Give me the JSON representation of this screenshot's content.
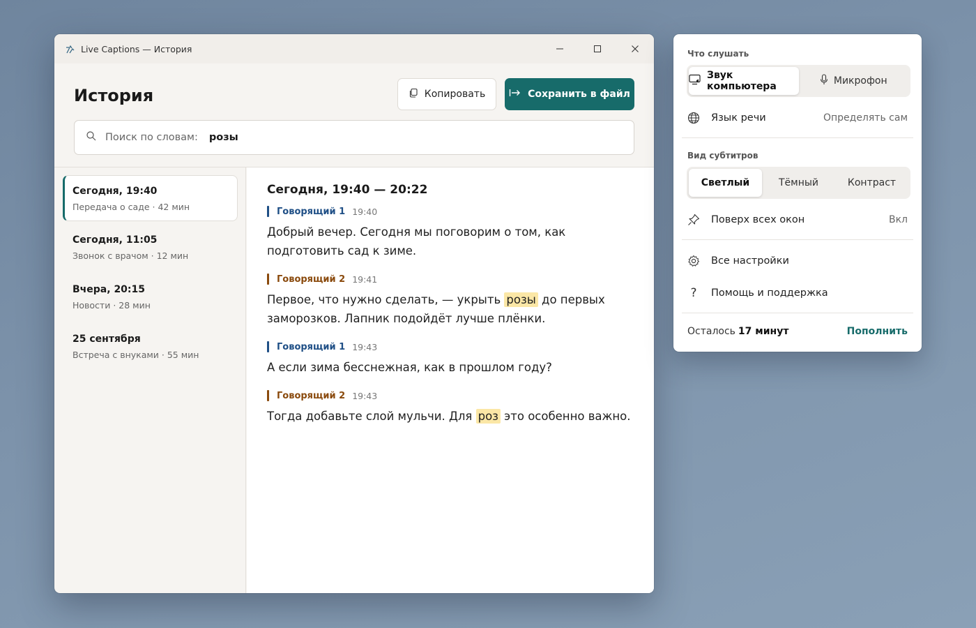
{
  "window": {
    "title": "Live Captions — История",
    "page_title": "История",
    "copy_label": "Копировать",
    "save_label": "Сохранить в файл",
    "search": {
      "label": "Поиск по словам:",
      "value": "розы"
    }
  },
  "sessions": [
    {
      "title": "Сегодня, 19:40",
      "subtitle": "Передача о саде · 42 мин",
      "active": true
    },
    {
      "title": "Сегодня, 11:05",
      "subtitle": "Звонок с врачом · 12 мин",
      "active": false
    },
    {
      "title": "Вчера, 20:15",
      "subtitle": "Новости · 28 мин",
      "active": false
    },
    {
      "title": "25 сентября",
      "subtitle": "Встреча с внуками · 55 мин",
      "active": false
    }
  ],
  "transcript": {
    "heading": "Сегодня, 19:40 — 20:22",
    "entries": [
      {
        "speaker": "Говорящий 1",
        "time": "19:40",
        "color": "#1f4f86",
        "parts": [
          {
            "t": "Добрый вечер. Сегодня мы поговорим о том, как подготовить сад к зиме."
          }
        ]
      },
      {
        "speaker": "Говорящий 2",
        "time": "19:41",
        "color": "#8a4a0d",
        "parts": [
          {
            "t": "Первое, что нужно сделать, — укрыть "
          },
          {
            "t": "розы",
            "hl": true
          },
          {
            "t": " до первых заморозков. Лапник подойдёт лучше плёнки."
          }
        ]
      },
      {
        "speaker": "Говорящий 1",
        "time": "19:43",
        "color": "#1f4f86",
        "parts": [
          {
            "t": "А если зима бесснежная, как в прошлом году?"
          }
        ]
      },
      {
        "speaker": "Говорящий 2",
        "time": "19:43",
        "color": "#8a4a0d",
        "parts": [
          {
            "t": "Тогда добавьте слой мульчи. Для "
          },
          {
            "t": "роз",
            "hl": true
          },
          {
            "t": " это особенно важно."
          }
        ]
      }
    ]
  },
  "flyout": {
    "listen_label": "Что слушать",
    "listen_options": {
      "computer": "Звук компьютера",
      "mic": "Микрофон",
      "selected": "computer"
    },
    "language": {
      "label": "Язык речи",
      "value": "Определять сам"
    },
    "style_label": "Вид субтитров",
    "style_options": {
      "light": "Светлый",
      "dark": "Тёмный",
      "contrast": "Контраст",
      "selected": "light"
    },
    "on_top": {
      "label": "Поверх всех окон",
      "value": "Вкл"
    },
    "all_settings": "Все настройки",
    "help": "Помощь и поддержка",
    "remaining_label": "Осталось",
    "remaining_value": "17 минут",
    "topup": "Пополнить"
  },
  "colors": {
    "accent": "#176b6a",
    "speaker1": "#1f4f86",
    "speaker2": "#8a4a0d",
    "highlight": "#fbe7a6"
  },
  "icons": [
    "captions-app-icon",
    "minimize-icon",
    "maximize-icon",
    "close-icon",
    "copy-icon",
    "export-icon",
    "search-icon",
    "monitor-icon",
    "microphone-icon",
    "globe-icon",
    "pin-icon",
    "gear-icon",
    "help-icon"
  ]
}
